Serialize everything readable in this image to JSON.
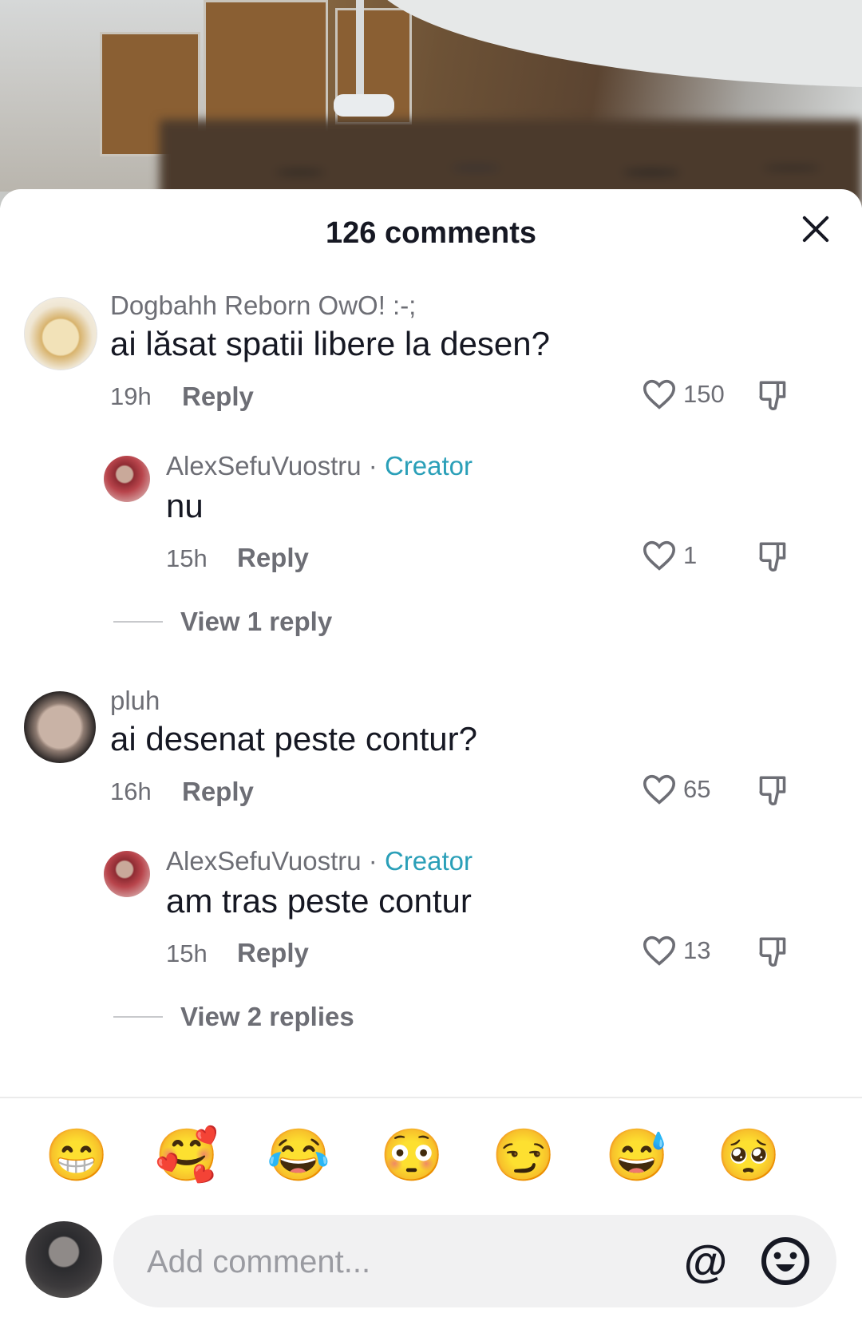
{
  "header": {
    "title": "126 comments"
  },
  "comments": [
    {
      "username": "Dogbahh Reborn OwO! :-;",
      "text": "ai lăsat spatii libere la desen?",
      "time": "19h",
      "reply_label": "Reply",
      "likes": "150",
      "replies": [
        {
          "username": "AlexSefuVuostru",
          "separator": "·",
          "badge": "Creator",
          "text": "nu",
          "time": "15h",
          "reply_label": "Reply",
          "likes": "1"
        }
      ],
      "view_replies": "View 1 reply"
    },
    {
      "username": "pluh",
      "text": "ai desenat peste contur?",
      "time": "16h",
      "reply_label": "Reply",
      "likes": "65",
      "replies": [
        {
          "username": "AlexSefuVuostru",
          "separator": "·",
          "badge": "Creator",
          "text": "am tras peste contur",
          "time": "15h",
          "reply_label": "Reply",
          "likes": "13"
        }
      ],
      "view_replies": "View 2 replies"
    }
  ],
  "quick_emojis": [
    "😁",
    "🥰",
    "😂",
    "😳",
    "😏",
    "😅",
    "🥺"
  ],
  "composer": {
    "placeholder": "Add comment...",
    "at_symbol": "@"
  },
  "colors": {
    "creator": "#2a9fb8",
    "muted": "#6d6e75",
    "text": "#161823"
  }
}
